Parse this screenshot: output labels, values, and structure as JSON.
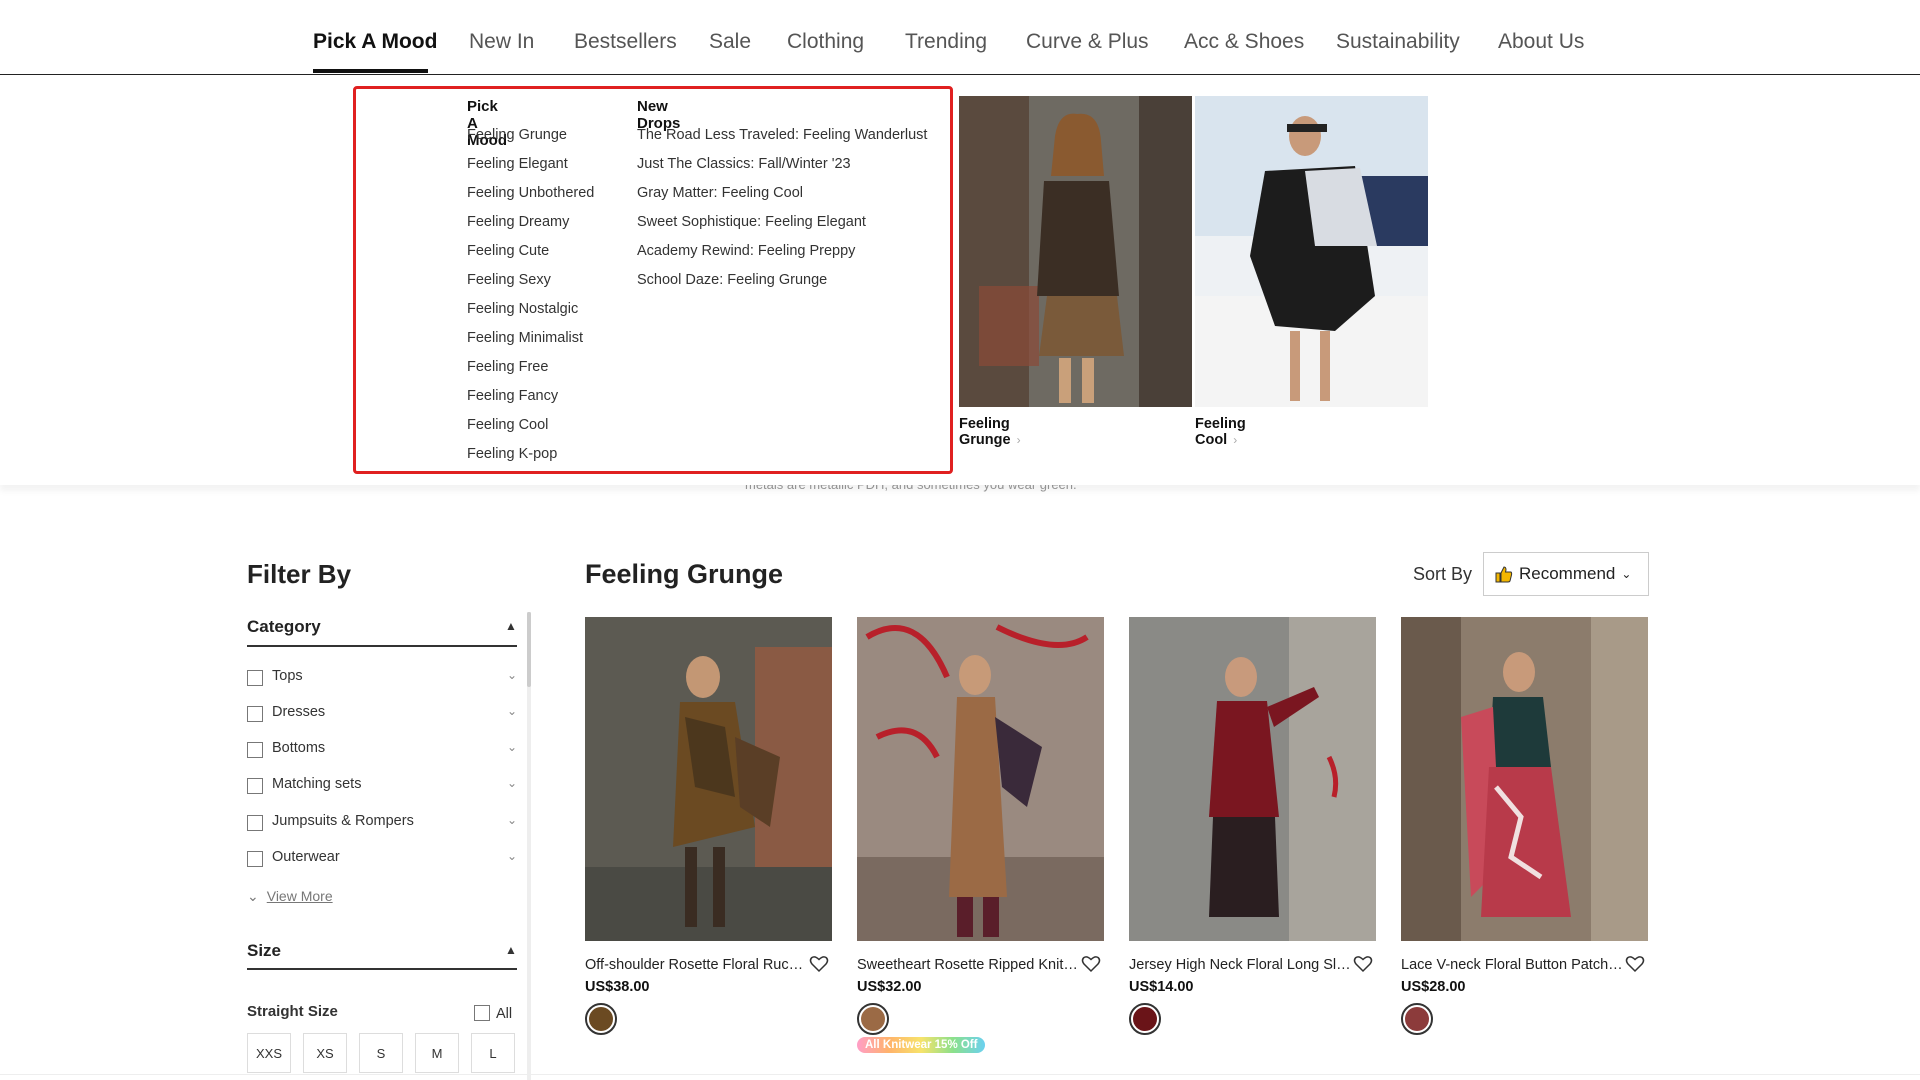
{
  "nav": {
    "items": [
      "Pick A Mood",
      "New In",
      "Bestsellers",
      "Sale",
      "Clothing",
      "Trending",
      "Curve & Plus",
      "Acc & Shoes",
      "Sustainability",
      "About Us"
    ],
    "active": "Pick A Mood"
  },
  "dropdown": {
    "col1": {
      "heading": "Pick A Mood",
      "links": [
        "Feeling Grunge",
        "Feeling Elegant",
        "Feeling Unbothered",
        "Feeling Dreamy",
        "Feeling Cute",
        "Feeling Sexy",
        "Feeling Nostalgic",
        "Feeling Minimalist",
        "Feeling Free",
        "Feeling Fancy",
        "Feeling Cool",
        "Feeling K-pop"
      ]
    },
    "col2": {
      "heading": "New Drops",
      "links": [
        "The Road Less Traveled: Feeling Wanderlust",
        "Just The Classics: Fall/Winter '23",
        "Gray Matter: Feeling Cool",
        "Sweet Sophistique: Feeling Elegant",
        "Academy Rewind: Feeling Preppy",
        "School Daze: Feeling Grunge"
      ]
    },
    "promos": [
      {
        "caption": "Feeling Grunge"
      },
      {
        "caption": "Feeling Cool"
      }
    ],
    "behind_text": "metals are metallic PDH, and sometimes you wear green."
  },
  "filter": {
    "title": "Filter By",
    "category": {
      "heading": "Category",
      "items": [
        "Tops",
        "Dresses",
        "Bottoms",
        "Matching sets",
        "Jumpsuits & Rompers",
        "Outerwear"
      ],
      "view_more": "View More"
    },
    "size": {
      "heading": "Size",
      "straight_label": "Straight Size",
      "all_label": "All",
      "options": [
        "XXS",
        "XS",
        "S",
        "M",
        "L"
      ]
    }
  },
  "main": {
    "title": "Feeling Grunge",
    "sort_label": "Sort By",
    "sort_value": "Recommend"
  },
  "products": [
    {
      "name": "Off-shoulder Rosette Floral Ruched Dress",
      "price": "US$38.00",
      "swatch": "#6b4a22"
    },
    {
      "name": "Sweetheart Rosette Ripped Knit Dress",
      "price": "US$32.00",
      "swatch": "#9b6a45",
      "badge": "All Knitwear 15% Off"
    },
    {
      "name": "Jersey High Neck Floral Long Sleeve Top",
      "price": "US$14.00",
      "swatch": "#6a1418"
    },
    {
      "name": "Lace V-neck Floral Button Patchwork Dress",
      "price": "US$28.00",
      "swatch": "#8c3b3b"
    }
  ],
  "colors": {
    "accent": "#e02020",
    "text": "#222222"
  }
}
